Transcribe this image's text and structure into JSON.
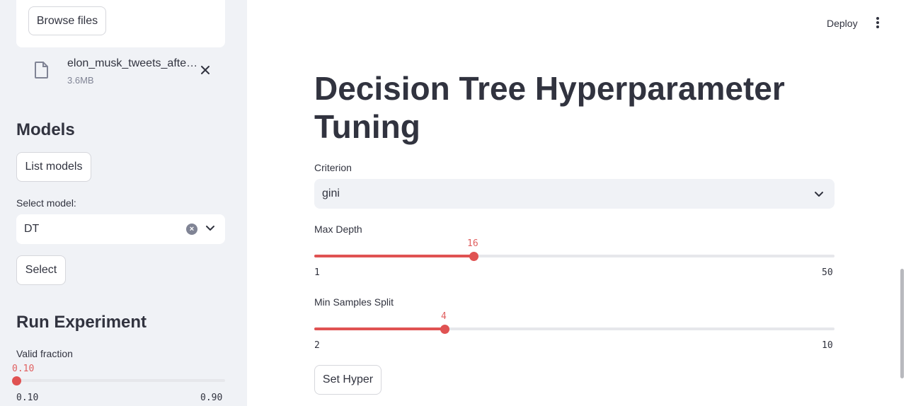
{
  "sidebar": {
    "uploader": {
      "browse_label": "Browse files"
    },
    "file": {
      "name": "elon_musk_tweets_afte…",
      "size": "3.6MB"
    },
    "models_heading": "Models",
    "list_models_label": "List models",
    "select_model": {
      "label": "Select model:",
      "value": "DT"
    },
    "select_label": "Select",
    "run_heading": "Run Experiment",
    "valid_fraction": {
      "label": "Valid fraction",
      "value": "0.10",
      "min": "0.10",
      "max": "0.90",
      "fraction": 0.0
    }
  },
  "header": {
    "deploy_label": "Deploy"
  },
  "main": {
    "title": "Decision Tree Hyperparameter Tuning",
    "criterion": {
      "label": "Criterion",
      "value": "gini"
    },
    "max_depth": {
      "label": "Max Depth",
      "value": "16",
      "min": "1",
      "max": "50"
    },
    "min_samples_split": {
      "label": "Min Samples Split",
      "value": "4",
      "min": "2",
      "max": "10"
    },
    "set_hyper_label": "Set Hyper"
  },
  "colors": {
    "accent": "#e05252",
    "sidebar_bg": "#f0f2f6",
    "text": "#31333f"
  },
  "icons": {
    "file": "file-icon",
    "close": "close-icon",
    "clear": "clear-icon",
    "chevron": "chevron-down-icon",
    "menu": "kebab-menu-icon"
  }
}
